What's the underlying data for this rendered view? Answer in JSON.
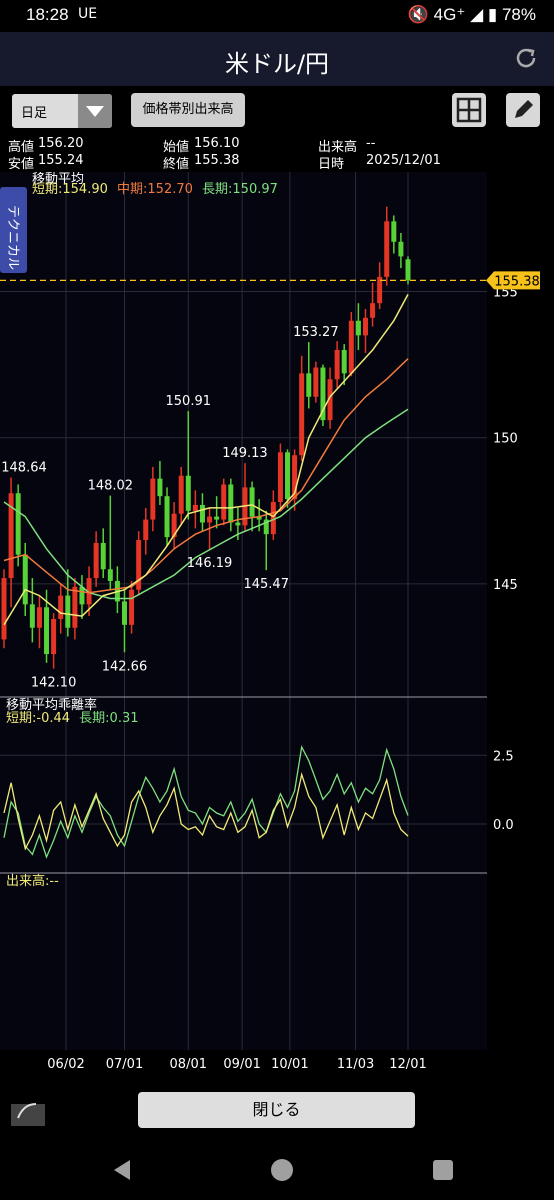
{
  "status_bar": {
    "time": "18:28",
    "left_icons": "UE",
    "network": "4G⁺",
    "battery": "78%"
  },
  "header": {
    "title": "米ドル/円"
  },
  "toolbar": {
    "period": "日足",
    "price_volume_button": "価格帯別出来高"
  },
  "ohlc": {
    "high_label": "高値",
    "high": "156.20",
    "open_label": "始値",
    "open": "156.10",
    "volume_label": "出来高",
    "volume": "--",
    "low_label": "安値",
    "low": "155.24",
    "close_label": "終値",
    "close": "155.38",
    "date_label": "日時",
    "date": "2025/12/01"
  },
  "technical_tab": "テクニカル",
  "ma_legend": {
    "title": "移動平均",
    "short": "短期:154.90",
    "mid": "中期:152.70",
    "long": "長期:150.97"
  },
  "dev_legend": {
    "title": "移動平均乖離率",
    "short": "短期:-0.44",
    "long": "長期:0.31"
  },
  "volume_legend": "出来高:--",
  "colors": {
    "up": "#e53524",
    "down": "#57d237",
    "short_ma": "#f0ea78",
    "mid_ma": "#f07a3c",
    "long_ma": "#7fe07f",
    "current": "#f7c21a",
    "bg": "#05050f"
  },
  "chart_data": {
    "type": "candlestick",
    "y_ticks": [
      "155",
      "150",
      "145"
    ],
    "ylim": [
      141.2,
      158.3
    ],
    "x_ticks": [
      "06/02",
      "07/01",
      "08/01",
      "09/01",
      "10/01",
      "11/03",
      "12/01"
    ],
    "current_price": "155.38",
    "annotations": [
      {
        "text": "148.64",
        "x": "05/06",
        "y": 148.64
      },
      {
        "text": "142.10",
        "x": "05/27",
        "y": 142.1
      },
      {
        "text": "148.02",
        "x": "06/23",
        "y": 148.02
      },
      {
        "text": "142.66",
        "x": "07/01",
        "y": 142.66
      },
      {
        "text": "150.91",
        "x": "08/01",
        "y": 150.91
      },
      {
        "text": "146.19",
        "x": "08/14",
        "y": 146.19
      },
      {
        "text": "149.13",
        "x": "09/03",
        "y": 149.13
      },
      {
        "text": "145.47",
        "x": "09/17",
        "y": 145.47
      },
      {
        "text": "153.27",
        "x": "10/14",
        "y": 153.27
      }
    ],
    "candles": [
      {
        "d": "05/01",
        "o": 143.1,
        "h": 145.5,
        "l": 142.8,
        "c": 145.2
      },
      {
        "d": "05/06",
        "o": 145.2,
        "h": 148.64,
        "l": 144.2,
        "c": 148.1
      },
      {
        "d": "05/08",
        "o": 148.1,
        "h": 148.4,
        "l": 145.6,
        "c": 146.0
      },
      {
        "d": "05/12",
        "o": 146.0,
        "h": 146.4,
        "l": 143.9,
        "c": 144.3
      },
      {
        "d": "05/15",
        "o": 144.3,
        "h": 145.2,
        "l": 143.0,
        "c": 143.5
      },
      {
        "d": "05/20",
        "o": 143.5,
        "h": 144.6,
        "l": 142.8,
        "c": 144.2
      },
      {
        "d": "05/23",
        "o": 144.2,
        "h": 144.8,
        "l": 142.3,
        "c": 142.6
      },
      {
        "d": "05/27",
        "o": 142.6,
        "h": 144.0,
        "l": 142.1,
        "c": 143.8
      },
      {
        "d": "05/30",
        "o": 143.8,
        "h": 145.0,
        "l": 143.3,
        "c": 144.6
      },
      {
        "d": "06/03",
        "o": 144.6,
        "h": 145.5,
        "l": 143.2,
        "c": 143.5
      },
      {
        "d": "06/06",
        "o": 143.5,
        "h": 145.2,
        "l": 143.1,
        "c": 144.9
      },
      {
        "d": "06/10",
        "o": 144.9,
        "h": 145.3,
        "l": 143.8,
        "c": 144.3
      },
      {
        "d": "06/13",
        "o": 144.3,
        "h": 145.6,
        "l": 143.9,
        "c": 145.2
      },
      {
        "d": "06/17",
        "o": 145.2,
        "h": 146.8,
        "l": 144.9,
        "c": 146.4
      },
      {
        "d": "06/20",
        "o": 146.4,
        "h": 146.9,
        "l": 145.2,
        "c": 145.5
      },
      {
        "d": "06/23",
        "o": 145.5,
        "h": 148.02,
        "l": 144.8,
        "c": 145.1
      },
      {
        "d": "06/26",
        "o": 145.1,
        "h": 145.6,
        "l": 144.0,
        "c": 144.4
      },
      {
        "d": "07/01",
        "o": 144.4,
        "h": 144.8,
        "l": 142.66,
        "c": 143.6
      },
      {
        "d": "07/04",
        "o": 143.6,
        "h": 145.1,
        "l": 143.3,
        "c": 144.8
      },
      {
        "d": "07/08",
        "o": 144.8,
        "h": 146.8,
        "l": 144.6,
        "c": 146.5
      },
      {
        "d": "07/11",
        "o": 146.5,
        "h": 147.6,
        "l": 146.0,
        "c": 147.2
      },
      {
        "d": "07/15",
        "o": 147.2,
        "h": 149.0,
        "l": 146.8,
        "c": 148.6
      },
      {
        "d": "07/18",
        "o": 148.6,
        "h": 149.2,
        "l": 147.7,
        "c": 148.0
      },
      {
        "d": "07/22",
        "o": 148.0,
        "h": 148.3,
        "l": 146.3,
        "c": 146.6
      },
      {
        "d": "07/25",
        "o": 146.6,
        "h": 147.8,
        "l": 146.2,
        "c": 147.4
      },
      {
        "d": "07/29",
        "o": 147.4,
        "h": 149.0,
        "l": 147.0,
        "c": 148.7
      },
      {
        "d": "08/01",
        "o": 148.7,
        "h": 150.91,
        "l": 147.2,
        "c": 147.5
      },
      {
        "d": "08/05",
        "o": 147.5,
        "h": 148.2,
        "l": 146.9,
        "c": 147.7
      },
      {
        "d": "08/08",
        "o": 147.7,
        "h": 148.1,
        "l": 146.8,
        "c": 147.1
      },
      {
        "d": "08/14",
        "o": 147.1,
        "h": 147.6,
        "l": 146.19,
        "c": 147.3
      },
      {
        "d": "08/18",
        "o": 147.3,
        "h": 148.0,
        "l": 146.9,
        "c": 147.2
      },
      {
        "d": "08/21",
        "o": 147.2,
        "h": 148.6,
        "l": 147.0,
        "c": 148.4
      },
      {
        "d": "08/26",
        "o": 148.4,
        "h": 148.6,
        "l": 146.8,
        "c": 147.1
      },
      {
        "d": "08/29",
        "o": 147.1,
        "h": 147.6,
        "l": 146.5,
        "c": 147.0
      },
      {
        "d": "09/03",
        "o": 147.0,
        "h": 149.13,
        "l": 146.8,
        "c": 148.3
      },
      {
        "d": "09/08",
        "o": 148.3,
        "h": 148.5,
        "l": 146.8,
        "c": 147.3
      },
      {
        "d": "09/11",
        "o": 147.3,
        "h": 147.9,
        "l": 146.8,
        "c": 147.2
      },
      {
        "d": "09/17",
        "o": 147.2,
        "h": 147.5,
        "l": 145.47,
        "c": 146.7
      },
      {
        "d": "09/22",
        "o": 146.7,
        "h": 148.2,
        "l": 146.5,
        "c": 147.8
      },
      {
        "d": "09/25",
        "o": 147.8,
        "h": 149.8,
        "l": 147.6,
        "c": 149.5
      },
      {
        "d": "09/30",
        "o": 149.5,
        "h": 149.6,
        "l": 147.6,
        "c": 147.9
      },
      {
        "d": "10/03",
        "o": 147.9,
        "h": 149.6,
        "l": 147.5,
        "c": 149.4
      },
      {
        "d": "10/07",
        "o": 149.4,
        "h": 152.8,
        "l": 149.2,
        "c": 152.2
      },
      {
        "d": "10/10",
        "o": 152.2,
        "h": 153.27,
        "l": 151.0,
        "c": 151.4
      },
      {
        "d": "10/14",
        "o": 151.4,
        "h": 152.6,
        "l": 151.2,
        "c": 152.4
      },
      {
        "d": "10/17",
        "o": 152.4,
        "h": 152.5,
        "l": 150.4,
        "c": 150.6
      },
      {
        "d": "10/21",
        "o": 150.6,
        "h": 152.4,
        "l": 150.3,
        "c": 152.0
      },
      {
        "d": "10/24",
        "o": 152.0,
        "h": 153.3,
        "l": 151.7,
        "c": 153.0
      },
      {
        "d": "10/28",
        "o": 153.0,
        "h": 153.2,
        "l": 151.8,
        "c": 152.2
      },
      {
        "d": "10/31",
        "o": 152.2,
        "h": 154.3,
        "l": 152.1,
        "c": 154.0
      },
      {
        "d": "11/05",
        "o": 154.0,
        "h": 154.6,
        "l": 153.0,
        "c": 153.5
      },
      {
        "d": "11/10",
        "o": 153.5,
        "h": 154.4,
        "l": 152.9,
        "c": 154.1
      },
      {
        "d": "11/14",
        "o": 154.1,
        "h": 155.3,
        "l": 153.8,
        "c": 154.6
      },
      {
        "d": "11/18",
        "o": 154.6,
        "h": 156.0,
        "l": 154.4,
        "c": 155.5
      },
      {
        "d": "11/20",
        "o": 155.5,
        "h": 157.9,
        "l": 155.2,
        "c": 157.4
      },
      {
        "d": "11/24",
        "o": 157.4,
        "h": 157.6,
        "l": 156.3,
        "c": 156.7
      },
      {
        "d": "11/27",
        "o": 156.7,
        "h": 157.0,
        "l": 155.8,
        "c": 156.2
      },
      {
        "d": "12/01",
        "o": 156.1,
        "h": 156.2,
        "l": 155.24,
        "c": 155.38
      }
    ],
    "ma_short": [
      [
        0,
        143.6
      ],
      [
        1,
        144.0
      ],
      [
        3,
        144.8
      ],
      [
        5,
        144.6
      ],
      [
        8,
        144.0
      ],
      [
        11,
        143.9
      ],
      [
        14,
        144.6
      ],
      [
        17,
        144.8
      ],
      [
        20,
        145.3
      ],
      [
        23,
        146.3
      ],
      [
        26,
        147.4
      ],
      [
        29,
        147.6
      ],
      [
        32,
        147.6
      ],
      [
        35,
        147.7
      ],
      [
        38,
        147.3
      ],
      [
        41,
        148.1
      ],
      [
        43,
        150.0
      ],
      [
        46,
        151.4
      ],
      [
        49,
        152.2
      ],
      [
        52,
        153.0
      ],
      [
        55,
        154.0
      ],
      [
        57,
        154.9
      ]
    ],
    "ma_mid": [
      [
        0,
        145.8
      ],
      [
        3,
        146.0
      ],
      [
        6,
        145.4
      ],
      [
        9,
        144.8
      ],
      [
        12,
        144.7
      ],
      [
        15,
        144.8
      ],
      [
        18,
        144.9
      ],
      [
        21,
        145.5
      ],
      [
        24,
        146.2
      ],
      [
        27,
        146.7
      ],
      [
        30,
        147.0
      ],
      [
        33,
        147.2
      ],
      [
        36,
        147.3
      ],
      [
        39,
        147.5
      ],
      [
        42,
        148.2
      ],
      [
        45,
        149.4
      ],
      [
        48,
        150.6
      ],
      [
        51,
        151.4
      ],
      [
        54,
        152.0
      ],
      [
        57,
        152.7
      ]
    ],
    "ma_long": [
      [
        0,
        147.8
      ],
      [
        3,
        147.3
      ],
      [
        6,
        146.2
      ],
      [
        9,
        145.3
      ],
      [
        12,
        144.7
      ],
      [
        15,
        144.5
      ],
      [
        18,
        144.5
      ],
      [
        21,
        144.9
      ],
      [
        24,
        145.3
      ],
      [
        27,
        145.9
      ],
      [
        30,
        146.3
      ],
      [
        33,
        146.7
      ],
      [
        36,
        147.0
      ],
      [
        39,
        147.3
      ],
      [
        42,
        147.9
      ],
      [
        45,
        148.6
      ],
      [
        48,
        149.3
      ],
      [
        51,
        150.0
      ],
      [
        54,
        150.5
      ],
      [
        57,
        150.97
      ]
    ],
    "deviation": {
      "ticks": [
        "2.5",
        "0.0"
      ],
      "ylim": [
        -1.6,
        3.6
      ],
      "short": [
        0.4,
        1.5,
        0.2,
        -0.9,
        -0.4,
        0.3,
        -0.6,
        0.5,
        0.8,
        -0.2,
        0.7,
        -0.1,
        0.5,
        1.1,
        0.2,
        -0.3,
        -0.8,
        -0.4,
        0.8,
        1.2,
        0.6,
        -0.3,
        0.3,
        0.7,
        1.3,
        0.0,
        -0.2,
        -0.1,
        -0.4,
        0.3,
        -0.1,
        -0.2,
        0.4,
        -0.3,
        -0.1,
        0.5,
        -0.5,
        -0.3,
        0.5,
        0.9,
        -0.1,
        0.6,
        1.8,
        1.0,
        0.6,
        -0.5,
        0.1,
        0.7,
        -0.4,
        0.6,
        -0.2,
        0.4,
        0.2,
        0.9,
        1.6,
        0.4,
        -0.2,
        -0.44
      ],
      "long": [
        -0.5,
        0.8,
        0.4,
        -0.8,
        -1.1,
        -0.4,
        -1.2,
        -0.6,
        0.1,
        -0.5,
        0.3,
        -0.3,
        0.4,
        1.0,
        0.6,
        0.3,
        -0.4,
        -0.8,
        0.1,
        1.0,
        1.7,
        1.3,
        0.8,
        1.2,
        2.0,
        1.0,
        0.5,
        0.4,
        0.0,
        0.6,
        0.4,
        0.3,
        0.8,
        0.1,
        0.4,
        0.9,
        0.0,
        -0.3,
        0.4,
        1.1,
        0.6,
        1.2,
        2.8,
        2.3,
        1.6,
        0.9,
        1.2,
        1.8,
        1.1,
        1.5,
        0.8,
        1.3,
        1.1,
        1.6,
        2.7,
        2.0,
        1.0,
        0.31
      ]
    }
  }
}
